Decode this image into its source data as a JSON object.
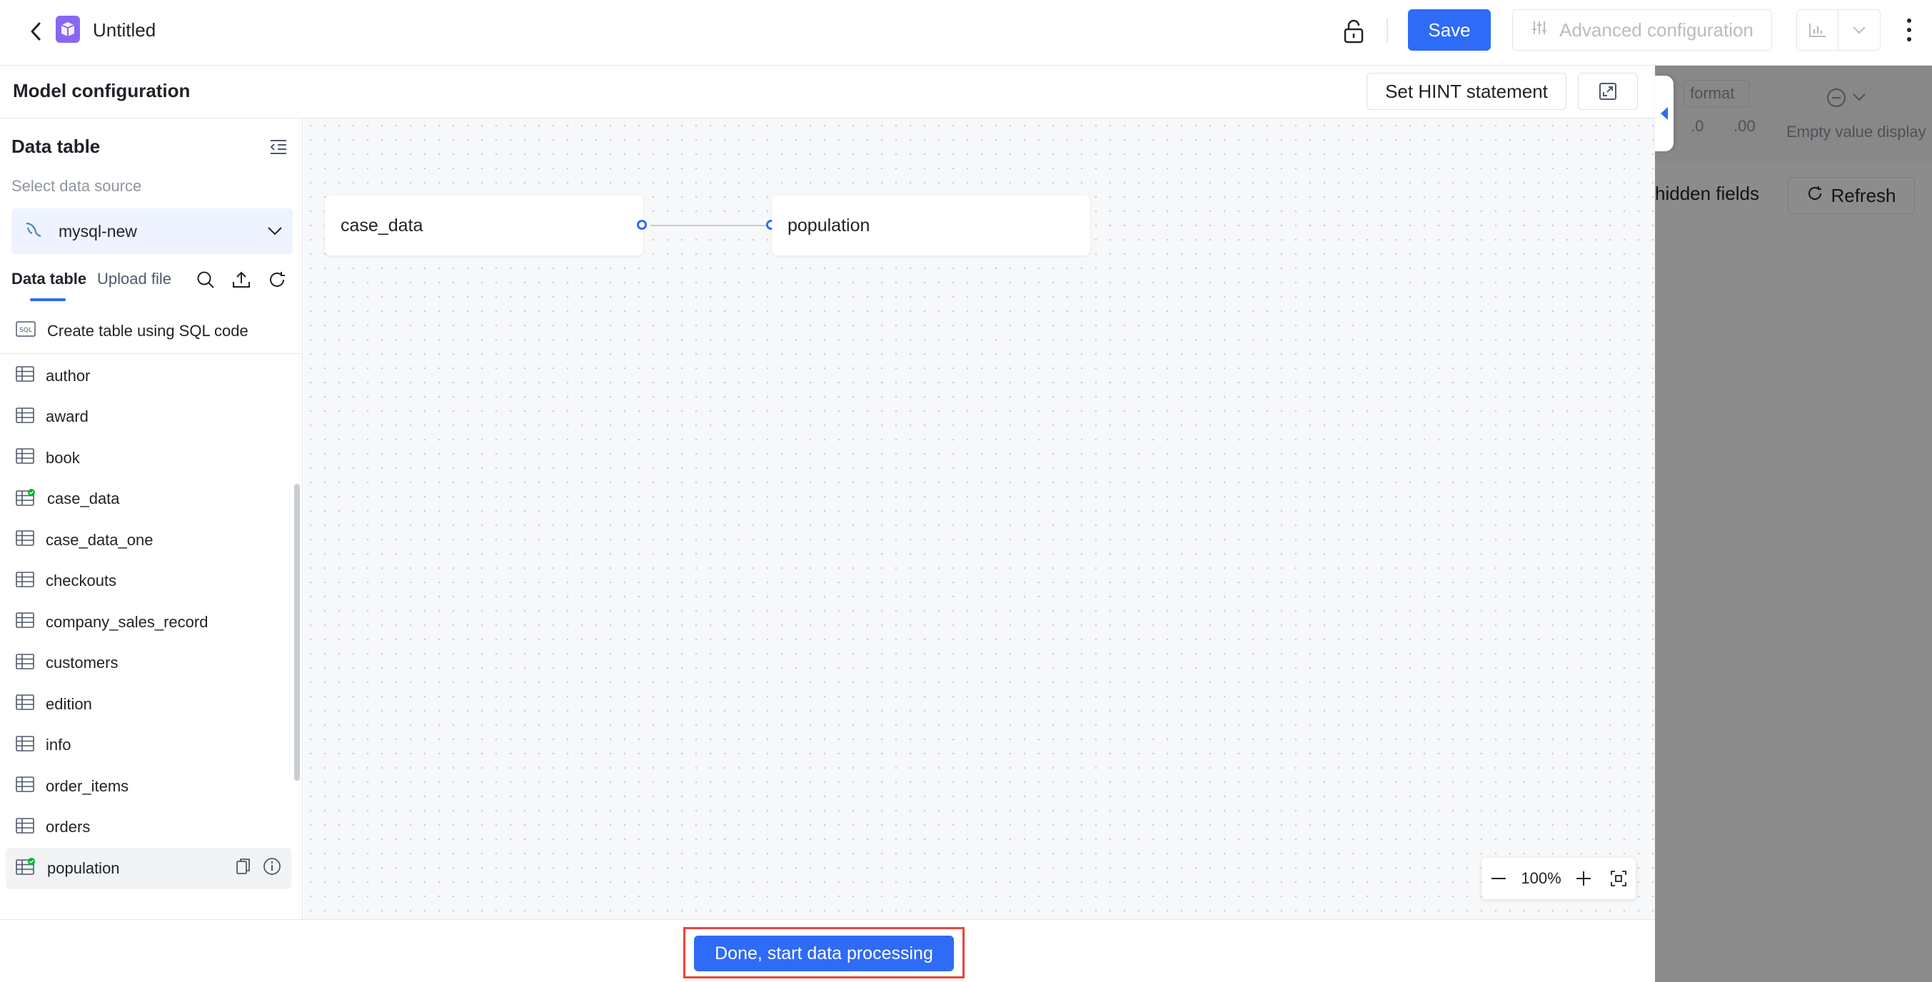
{
  "topbar": {
    "title": "Untitled",
    "save_label": "Save",
    "advanced_label": "Advanced configuration"
  },
  "background_panel": {
    "format_label": "format",
    "num1": ".0",
    "num2": ".00",
    "empty_value_label": "Empty value display",
    "hidden_fields_label": "hidden fields",
    "refresh_label": "Refresh"
  },
  "panel": {
    "title": "Model configuration",
    "hint_label": "Set HINT statement"
  },
  "sidebar": {
    "title": "Data table",
    "source_label": "Select data source",
    "source_name": "mysql-new",
    "tabs": [
      {
        "label": "Data table"
      },
      {
        "label": "Upload file"
      }
    ],
    "create_sql_label": "Create table using SQL code",
    "sql_badge": "SQL",
    "tables": [
      {
        "label": "author"
      },
      {
        "label": "award"
      },
      {
        "label": "book"
      },
      {
        "label": "case_data"
      },
      {
        "label": "case_data_one"
      },
      {
        "label": "checkouts"
      },
      {
        "label": "company_sales_record"
      },
      {
        "label": "customers"
      },
      {
        "label": "edition"
      },
      {
        "label": "info"
      },
      {
        "label": "order_items"
      },
      {
        "label": "orders"
      },
      {
        "label": "population"
      }
    ]
  },
  "canvas": {
    "nodes": [
      {
        "label": "case_data"
      },
      {
        "label": "population"
      }
    ],
    "zoom_level": "100%"
  },
  "footer": {
    "done_label": "Done, start data processing"
  },
  "colors": {
    "primary": "#2e6bf6",
    "highlight_border": "#e8453c",
    "used_badge": "#00b42a"
  }
}
